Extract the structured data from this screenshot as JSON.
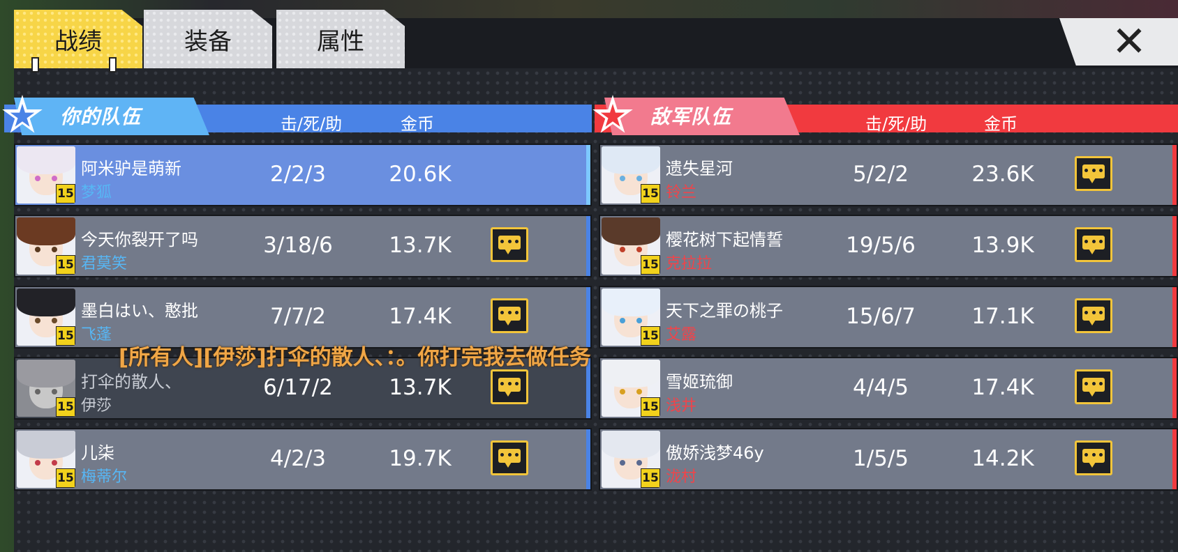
{
  "tabs": [
    {
      "label": "战绩",
      "active": true
    },
    {
      "label": "装备",
      "active": false
    },
    {
      "label": "属性",
      "active": false
    }
  ],
  "close_label": "✕",
  "your_team": {
    "title": "你的队伍",
    "col_kda": "击/死/助",
    "col_gold": "金币",
    "accent": "#4a83e6",
    "players": [
      {
        "name": "阿米驴是萌新",
        "character": "梦狐",
        "level": "15",
        "kda": "2/2/3",
        "gold": "20.6K",
        "state": "me",
        "hair": "#ece7f2",
        "eye": "#d06cc7"
      },
      {
        "name": "今天你裂开了吗",
        "character": "君莫笑",
        "level": "15",
        "kda": "3/18/6",
        "gold": "13.7K",
        "state": "alive",
        "hair": "#6b3a22",
        "eye": "#5a3a20"
      },
      {
        "name": "墨白はい、憨批",
        "character": "飞蓬",
        "level": "15",
        "kda": "7/7/2",
        "gold": "17.4K",
        "state": "alive",
        "hair": "#222227",
        "eye": "#6a4a2a"
      },
      {
        "name": "打伞的散人、",
        "character": "伊莎",
        "level": "15",
        "kda": "6/17/2",
        "gold": "13.7K",
        "state": "dead",
        "hair": "#9a9aa0",
        "eye": "#666"
      },
      {
        "name": "儿柒",
        "character": "梅蒂尔",
        "level": "15",
        "kda": "4/2/3",
        "gold": "19.7K",
        "state": "alive",
        "hair": "#c9ccd6",
        "eye": "#c23a4a"
      }
    ]
  },
  "enemy_team": {
    "title": "敌军队伍",
    "col_kda": "击/死/助",
    "col_gold": "金币",
    "accent": "#f13a3f",
    "players": [
      {
        "name": "遗失星河",
        "character": "铃兰",
        "level": "15",
        "kda": "5/2/2",
        "gold": "23.6K",
        "hair": "#dfe9f5",
        "eye": "#6ab0e0"
      },
      {
        "name": "樱花树下起情誓",
        "character": "克拉拉",
        "level": "15",
        "kda": "19/5/6",
        "gold": "13.9K",
        "hair": "#5a3a2a",
        "eye": "#c0402a"
      },
      {
        "name": "天下之罪の桃子",
        "character": "艾露",
        "level": "15",
        "kda": "15/6/7",
        "gold": "17.1K",
        "hair": "#e8f0fa",
        "eye": "#4aa0d8"
      },
      {
        "name": "雪姬琉御",
        "character": "浅井",
        "level": "15",
        "kda": "4/4/5",
        "gold": "17.4K",
        "hair": "#eef0f4",
        "eye": "#d8a020"
      },
      {
        "name": "傲娇浅梦46y",
        "character": "泷村",
        "level": "15",
        "kda": "1/5/5",
        "gold": "14.2K",
        "hair": "#e4e8f0",
        "eye": "#5a6a90"
      }
    ]
  },
  "chat_message": "[所有人][伊莎]打伞的散人、：。你打完我去做任务",
  "colors": {
    "ally_char_name": "#57b6f4",
    "enemy_char_name": "#f0444a",
    "chat_text": "#f0a646",
    "tab_active": "#f7d547"
  }
}
